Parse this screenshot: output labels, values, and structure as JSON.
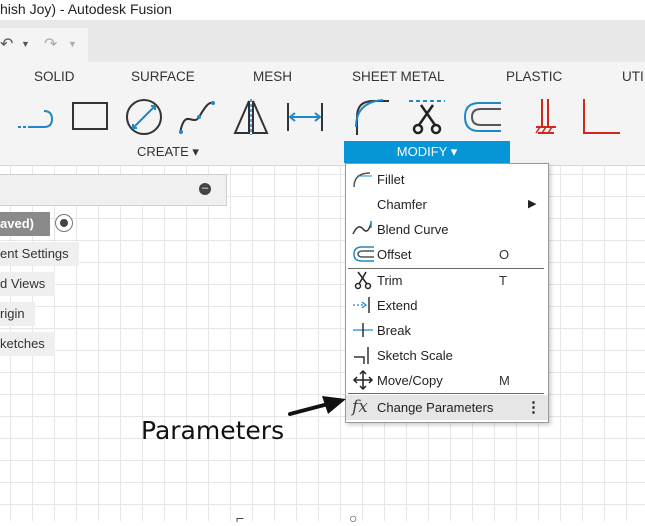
{
  "window": {
    "title": "hish Joy) - Autodesk Fusion"
  },
  "quick_access": {
    "undo_icon": "undo-icon",
    "redo_icon": "redo-icon"
  },
  "ribbon": {
    "tabs": [
      "SOLID",
      "SURFACE",
      "MESH",
      "SHEET METAL",
      "PLASTIC",
      "UTI"
    ],
    "create_group": {
      "label": "CREATE ▾",
      "tools": [
        "line-icon",
        "rectangle-icon",
        "circle-icon",
        "spline-icon",
        "mirror-icon",
        "dimension-icon"
      ]
    },
    "modify_group": {
      "label": "MODIFY ▾",
      "tools": [
        "fillet-icon",
        "trim-icon",
        "offset-icon"
      ]
    },
    "constraints_tools": [
      "constraint-icon",
      "perpendicular-icon"
    ]
  },
  "browser": {
    "nodes": [
      {
        "label": "aved)"
      },
      {
        "label": "ent Settings"
      },
      {
        "label": "d Views"
      },
      {
        "label": "rigin"
      },
      {
        "label": "ketches"
      }
    ]
  },
  "modify_menu": {
    "items": [
      {
        "label": "Fillet",
        "icon": "fillet-icon",
        "shortcut": ""
      },
      {
        "label": "Chamfer",
        "icon": "",
        "shortcut": "",
        "submenu": true
      },
      {
        "label": "Blend Curve",
        "icon": "blend-curve-icon",
        "shortcut": ""
      },
      {
        "label": "Offset",
        "icon": "offset-icon",
        "shortcut": "O"
      },
      {
        "label": "Trim",
        "icon": "trim-icon",
        "shortcut": "T"
      },
      {
        "label": "Extend",
        "icon": "extend-icon",
        "shortcut": ""
      },
      {
        "label": "Break",
        "icon": "break-icon",
        "shortcut": ""
      },
      {
        "label": "Sketch Scale",
        "icon": "sketch-scale-icon",
        "shortcut": ""
      },
      {
        "label": "Move/Copy",
        "icon": "move-icon",
        "shortcut": "M"
      },
      {
        "label": "Change Parameters",
        "icon": "fx-icon",
        "shortcut": "",
        "highlighted": true
      }
    ]
  },
  "annotation": {
    "text": "Parameters"
  },
  "colors": {
    "accent": "#0696d7",
    "tool_blue": "#1e88c8",
    "red": "#d0281e"
  }
}
